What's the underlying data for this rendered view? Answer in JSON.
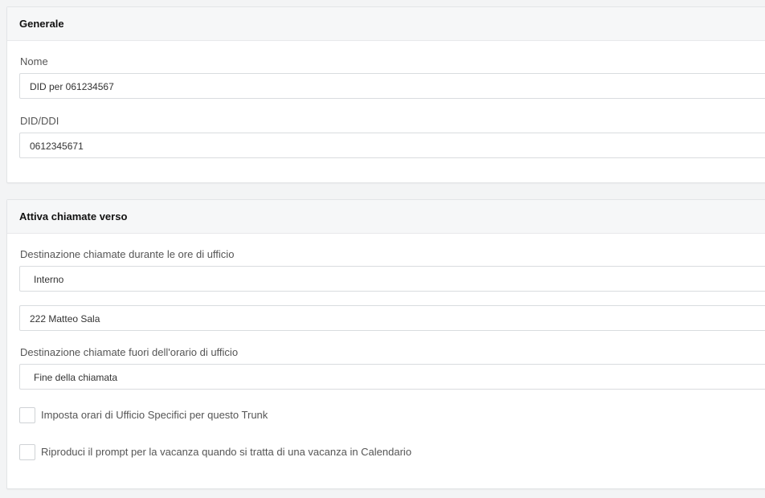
{
  "general": {
    "title": "Generale",
    "name_label": "Nome",
    "name_value": "DID per 061234567",
    "did_label": "DID/DDI",
    "did_value": "0612345671"
  },
  "routing": {
    "title": "Attiva chiamate verso",
    "office_hours_label": "Destinazione chiamate durante le ore di ufficio",
    "office_hours_type": "Interno",
    "office_hours_target": "222 Matteo Sala",
    "outside_hours_label": "Destinazione chiamate fuori dell'orario di ufficio",
    "outside_hours_type": "Fine della chiamata",
    "specific_hours_checkbox": {
      "label": "Imposta orari di Ufficio Specifici per questo Trunk",
      "checked": false
    },
    "holiday_prompt_checkbox": {
      "label": "Riproduci il prompt per la vacanza quando si tratta di una vacanza in Calendario",
      "checked": false
    }
  }
}
